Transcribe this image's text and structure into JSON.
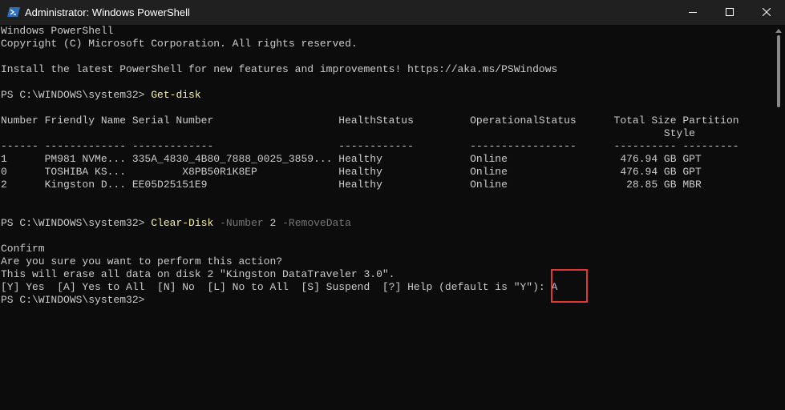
{
  "window": {
    "title": "Administrator: Windows PowerShell",
    "icon": "powershell-icon",
    "accent_highlight": "#e0373b"
  },
  "console": {
    "banner": [
      "Windows PowerShell",
      "Copyright (C) Microsoft Corporation. All rights reserved.",
      "",
      "Install the latest PowerShell for new features and improvements! https://aka.ms/PSWindows"
    ],
    "prompt": "PS C:\\WINDOWS\\system32> ",
    "cmd1": "Get-disk",
    "table": {
      "header1": "Number Friendly Name Serial Number                    HealthStatus         OperationalStatus      Total Size Partition",
      "header2": "                                                                                                          Style",
      "separator": "------ ------------- -------------                    ------------         -----------------      ---------- ---------",
      "rows": [
        "1      PM981 NVMe... 335A_4830_4B80_7888_0025_3859... Healthy              Online                  476.94 GB GPT",
        "0      TOSHIBA KS...         X8PB50R1K8EP             Healthy              Online                  476.94 GB GPT",
        "2      Kingston D... EE05D25151E9                     Healthy              Online                   28.85 GB MBR"
      ]
    },
    "cmd2": {
      "name": "Clear-Disk",
      "param1": "-Number",
      "value1": "2",
      "param2": "-RemoveData"
    },
    "confirm": {
      "title": "Confirm",
      "question": "Are you sure you want to perform this action?",
      "detail": "This will erase all data on disk 2 \"Kingston DataTraveler 3.0\".",
      "options": "[Y] Yes  [A] Yes to All  [N] No  [L] No to All  [S] Suspend  [?] Help (default is \"Y\"): A"
    },
    "final_prompt": "PS C:\\WINDOWS\\system32>"
  }
}
